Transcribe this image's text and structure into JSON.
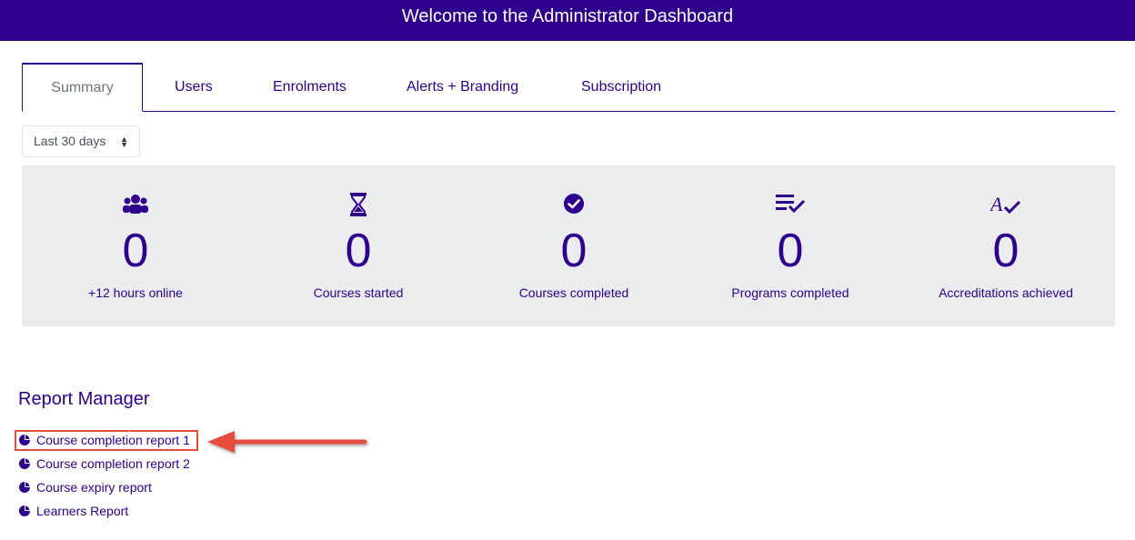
{
  "header": {
    "title": "Welcome to the Administrator Dashboard"
  },
  "tabs": [
    {
      "label": "Summary",
      "active": true
    },
    {
      "label": "Users"
    },
    {
      "label": "Enrolments"
    },
    {
      "label": "Alerts + Branding"
    },
    {
      "label": "Subscription"
    }
  ],
  "period_select": {
    "value": "Last 30 days"
  },
  "stats": [
    {
      "icon": "users-icon",
      "value": "0",
      "label": "+12 hours online"
    },
    {
      "icon": "hourglass-icon",
      "value": "0",
      "label": "Courses started"
    },
    {
      "icon": "check-circle-icon",
      "value": "0",
      "label": "Courses completed"
    },
    {
      "icon": "list-check-icon",
      "value": "0",
      "label": "Programs completed"
    },
    {
      "icon": "spell-check-icon",
      "value": "0",
      "label": "Accreditations achieved"
    }
  ],
  "report_manager": {
    "title": "Report Manager",
    "reports": [
      {
        "label": "Course completion report 1",
        "highlighted": true
      },
      {
        "label": "Course completion report 2"
      },
      {
        "label": "Course expiry report"
      },
      {
        "label": "Learners Report"
      }
    ]
  },
  "colors": {
    "brand": "#2e008b",
    "panel": "#ebecee",
    "annotation": "#e74c3c"
  }
}
